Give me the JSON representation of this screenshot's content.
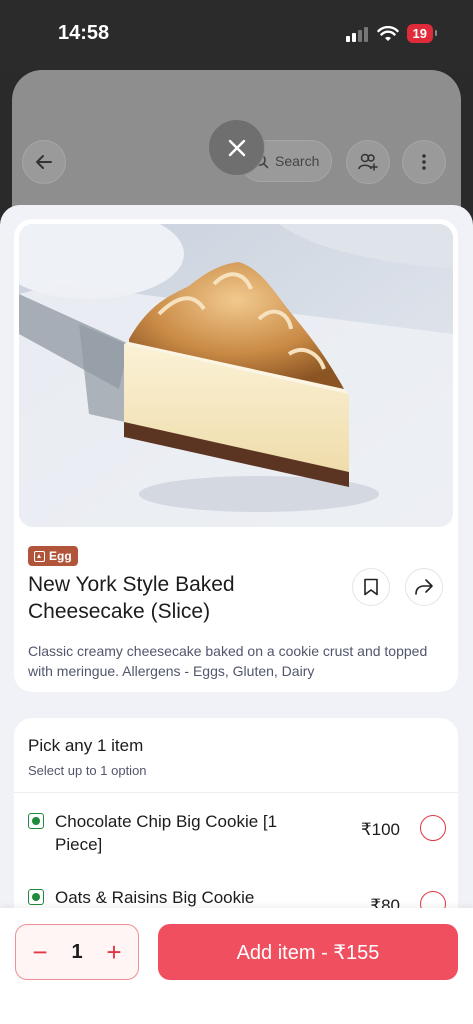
{
  "status_bar": {
    "time": "14:58",
    "battery": "19"
  },
  "background_header": {
    "search_label": "Search"
  },
  "product": {
    "badge": "Egg",
    "title": "New York Style Baked Cheesecake (Slice)",
    "description": "Classic creamy cheesecake baked on a cookie crust and topped with meringue. Allergens - Eggs, Gluten, Dairy"
  },
  "options": {
    "title": "Pick any 1 item",
    "subtitle": "Select up to 1 option",
    "items": [
      {
        "name": "Chocolate Chip Big Cookie [1 Piece]",
        "price": "₹100"
      },
      {
        "name": "Oats & Raisins Big Cookie",
        "price": "₹80"
      }
    ]
  },
  "cart": {
    "quantity": "1",
    "minus": "−",
    "plus": "+",
    "add_label": "Add item - ₹155"
  },
  "colors": {
    "accent": "#ef4f5f",
    "veg": "#1f8a3a",
    "egg_badge": "#b0553a"
  }
}
